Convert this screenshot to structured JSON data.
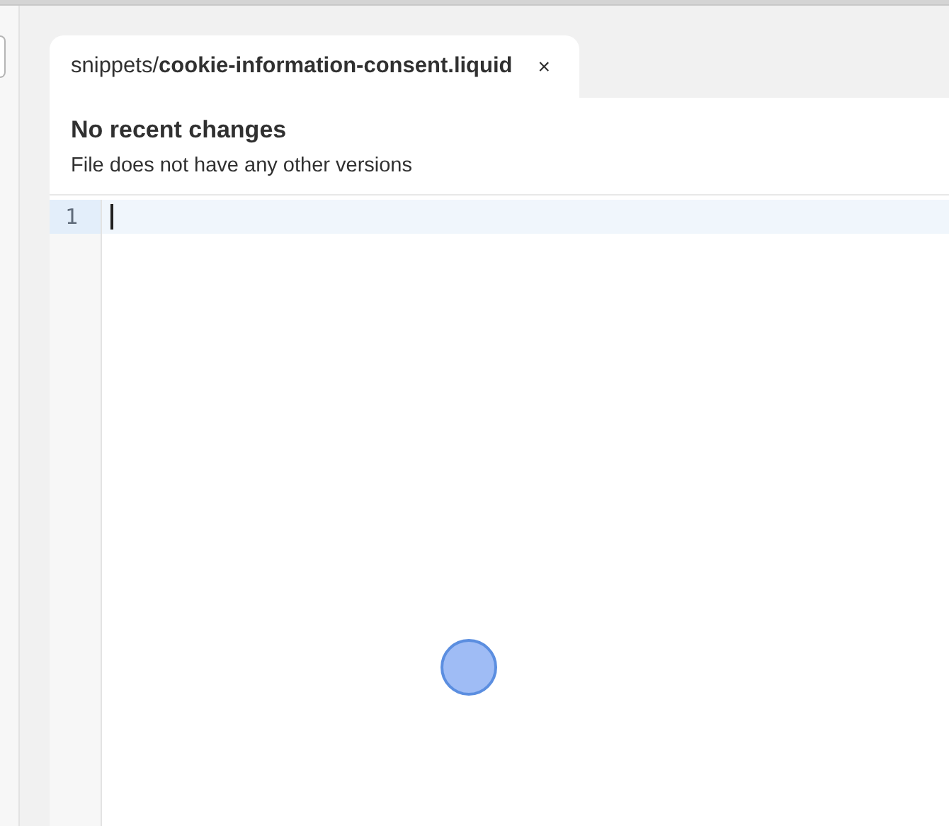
{
  "tabs": [
    {
      "label": "snippets/**cookie-information-consent.liquid**",
      "close": "×",
      "selected": true
    }
  ],
  "history": {
    "title": "No recent changes",
    "subtitle": "File does not have any other versions"
  },
  "editor": {
    "lines": [
      {
        "number": "1",
        "current": true
      }
    ]
  }
}
